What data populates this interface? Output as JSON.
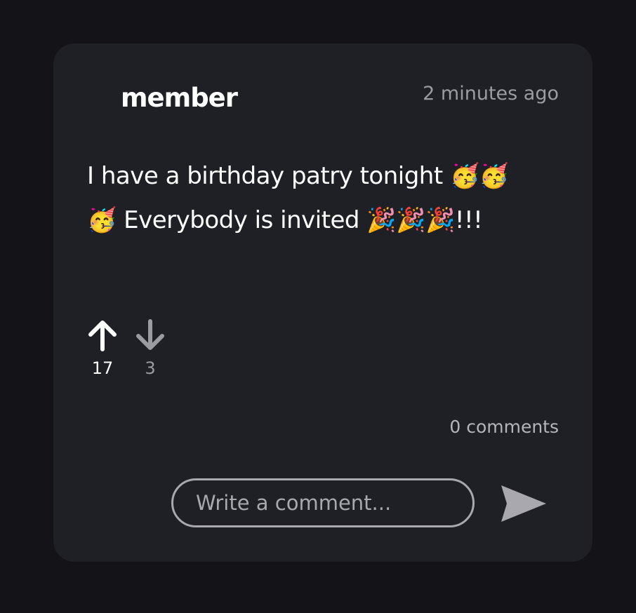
{
  "post": {
    "author": "member",
    "timestamp": "2 minutes ago",
    "line1": "I have a birthday patry tonight 🥳🥳",
    "line2": "🥳 Everybody is invited 🎉🎉🎉!!!",
    "upvotes": "17",
    "downvotes": "3",
    "comments_count": "0 comments"
  },
  "comment_box": {
    "placeholder": "Write a comment..."
  },
  "icons": {
    "upvote": "arrow-up-icon",
    "downvote": "arrow-down-icon",
    "send": "send-icon"
  },
  "colors": {
    "page_background": "#141418",
    "card_background": "#1f2026",
    "text_primary": "#ffffff",
    "text_muted": "#9b9ba2",
    "control_outline": "#a8a8ae"
  }
}
